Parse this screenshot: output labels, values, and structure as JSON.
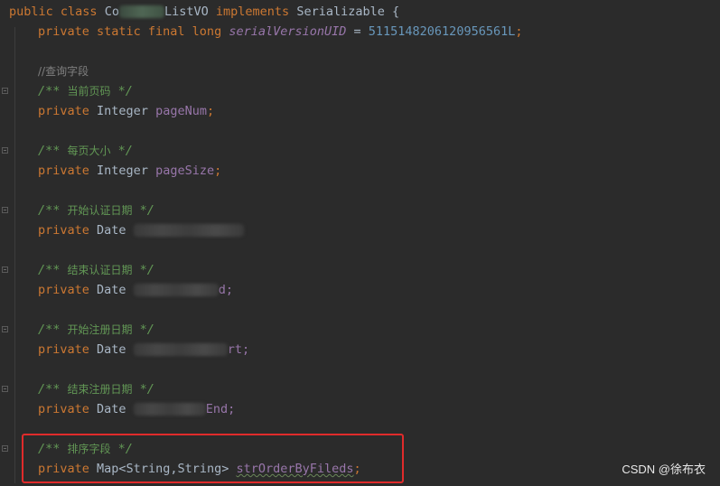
{
  "code": {
    "line1": {
      "kw_public": "public",
      "kw_class": "class",
      "class_prefix": "Co",
      "class_suffix": "ListVO",
      "kw_implements": "implements",
      "iface": "Serializable",
      "brace": "{"
    },
    "line2": {
      "mods": "private static final long",
      "name": "serialVersionUID",
      "eq": " = ",
      "value": "5115148206120956561L",
      "semi": ";"
    },
    "query_comment": "//查询字段",
    "fields": [
      {
        "doc": "当前页码",
        "type": "Integer",
        "name": "pageNum",
        "name_tail": ";"
      },
      {
        "doc": "每页大小",
        "type": "Integer",
        "name": "pageSize",
        "name_tail": ";"
      },
      {
        "doc": "开始认证日期",
        "type": "Date",
        "name": "",
        "name_tail": ""
      },
      {
        "doc": "结束认证日期",
        "type": "Date",
        "name": "",
        "name_tail": "d;"
      },
      {
        "doc": "开始注册日期",
        "type": "Date",
        "name": "",
        "name_tail": "rt;"
      },
      {
        "doc": "结束注册日期",
        "type": "Date",
        "name": "",
        "name_tail": "End;"
      },
      {
        "doc": "排序字段",
        "type": "Map<String,String>",
        "name": "strOrderByFileds",
        "name_tail": ";"
      }
    ],
    "kw_private": "private",
    "doc_open": "/** ",
    "doc_close": " */"
  },
  "watermark": "CSDN @徐布衣",
  "colors": {
    "background": "#2b2b2b",
    "keyword": "#cc7832",
    "field": "#9876aa",
    "number": "#6897bb",
    "doc_comment": "#629755",
    "highlight": "#e02b2b"
  }
}
